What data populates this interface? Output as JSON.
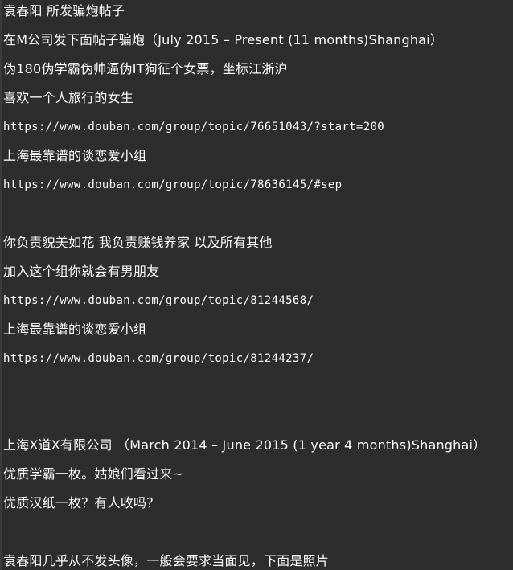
{
  "terminal": {
    "lines": [
      "袁春阳 所发骗炮帖子",
      "在M公司发下面帖子骗炮（July 2015 – Present (11 months)Shanghai）",
      "伪180伪学霸伪帅逼伪IT狗征个女票，坐标江浙沪",
      "喜欢一个人旅行的女生",
      "https://www.douban.com/group/topic/76651043/?start=200",
      "上海最靠谱的谈恋爱小组",
      "https://www.douban.com/group/topic/78636145/#sep",
      "",
      "你负责貌美如花 我负责赚钱养家 以及所有其他",
      "加入这个组你就会有男朋友",
      "https://www.douban.com/group/topic/81244568/",
      "上海最靠谱的谈恋爱小组",
      "https://www.douban.com/group/topic/81244237/",
      "",
      "",
      "上海X道X有限公司 （March 2014 – June 2015 (1 year 4 months)Shanghai）",
      "优质学霸一枚。姑娘们看过来~",
      "优质汉纸一枚？有人收吗？",
      "",
      "袁春阳几乎从不发头像，一般会要求当面见，下面是照片"
    ]
  }
}
